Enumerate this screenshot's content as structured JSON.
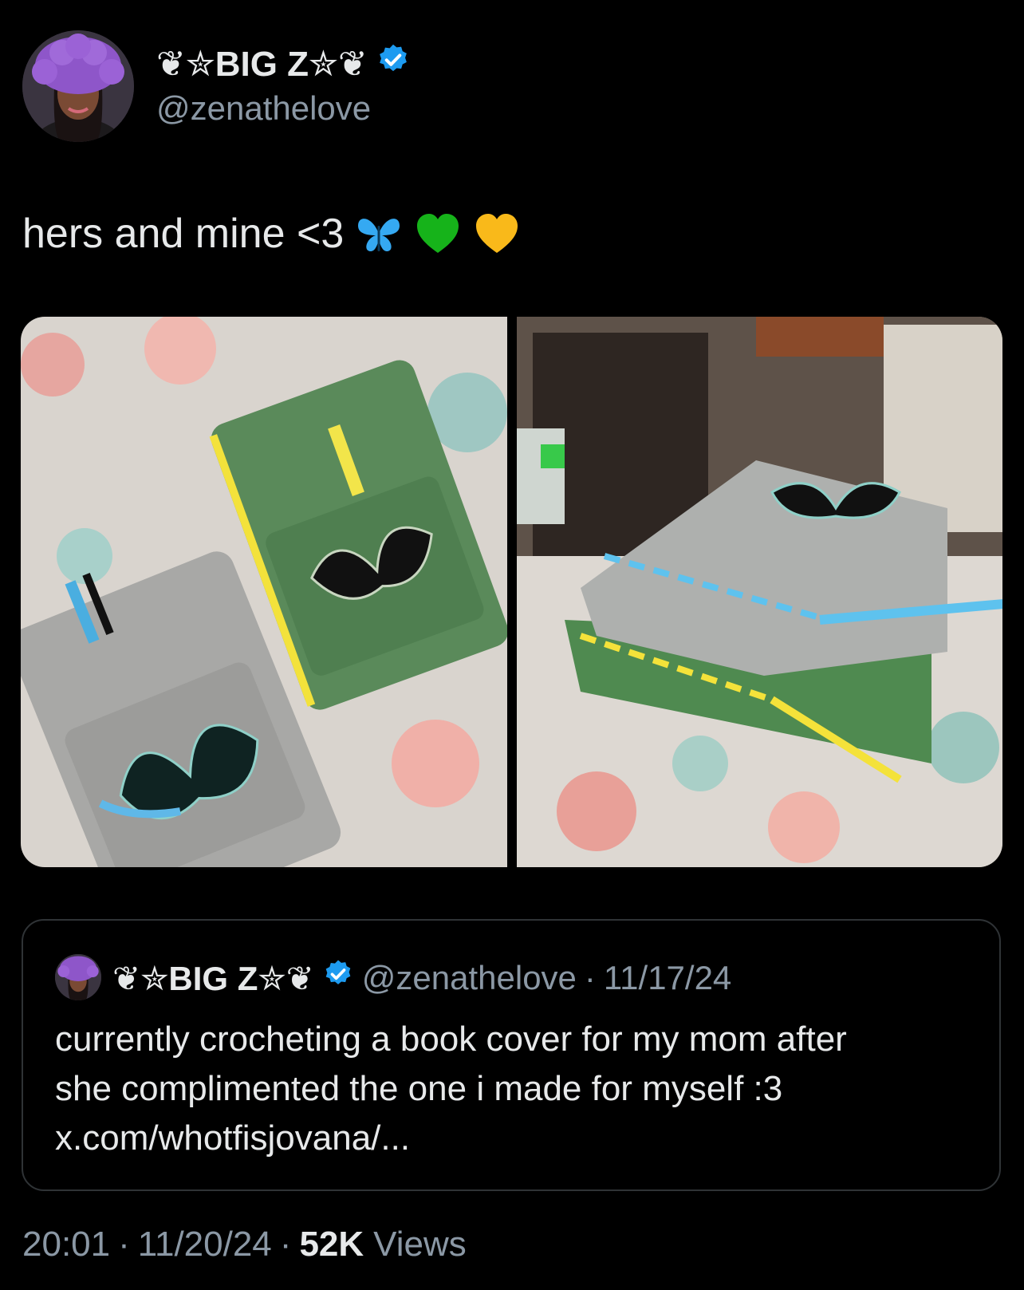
{
  "author": {
    "display_name": "❦✮BIG Z✮❦",
    "handle": "@zenathelove",
    "verified": true,
    "badge_color": "#1d9bf0"
  },
  "tweet": {
    "text": "hers and mine <3",
    "emojis": [
      "blue-butterfly",
      "green-heart",
      "yellow-heart"
    ]
  },
  "media": [
    {
      "description_icon": "photo-crochet-book-covers-flat"
    },
    {
      "description_icon": "photo-crochet-book-covers-stacked"
    }
  ],
  "quoted_tweet": {
    "display_name": "❦✮BIG Z✮❦",
    "handle": "@zenathelove",
    "separator": "·",
    "date": "11/17/24",
    "lines": [
      "currently crocheting a book cover for my mom after",
      "she complimented the one i made for myself :3",
      "x.com/whotfisjovana/..."
    ]
  },
  "footer": {
    "time": "20:01",
    "separator": "·",
    "date": "11/20/24",
    "views_count": "52K",
    "views_label": "Views"
  }
}
